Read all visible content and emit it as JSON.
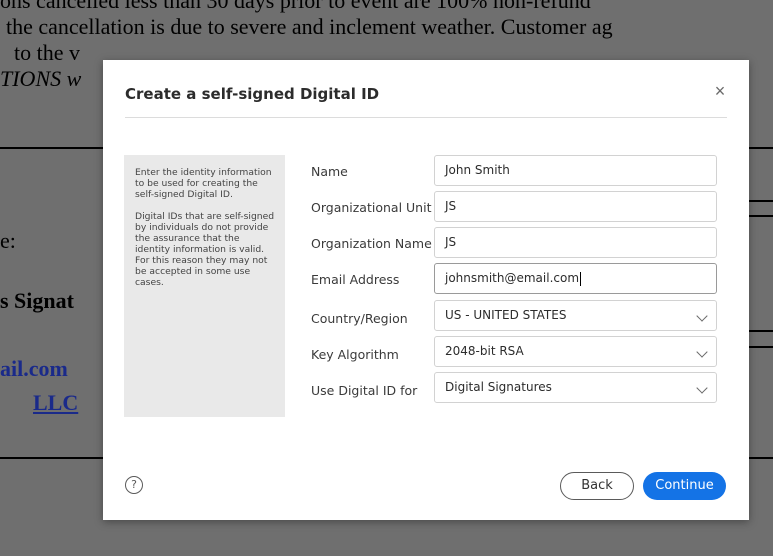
{
  "background_document": {
    "line1": "ons cancelled less than 30 days prior to event are 100% non-refund",
    "line2": "the cancellation is due to severe and inclement weather.  Customer ag",
    "line3": " to the v",
    "line4": "TIONS w",
    "line5": "e:",
    "line6": "s Signat",
    "line7": "ail.com",
    "line8": "LLC"
  },
  "dialog": {
    "title": "Create a self-signed Digital ID",
    "close_glyph": "×",
    "info_paragraph_1": "Enter the identity information to be used for creating the self-signed Digital ID.",
    "info_paragraph_2": "Digital IDs that are self-signed by individuals do not provide the assurance that the identity information is valid. For this reason they may not be accepted in some use cases.",
    "fields": {
      "name": {
        "label": "Name",
        "value": "John Smith"
      },
      "org_unit": {
        "label": "Organizational Unit",
        "value": "JS"
      },
      "org_name": {
        "label": "Organization Name",
        "value": "JS"
      },
      "email": {
        "label": "Email Address",
        "value": "johnsmith@email.com"
      },
      "country": {
        "label": "Country/Region",
        "value": "US - UNITED STATES"
      },
      "key_algorithm": {
        "label": "Key Algorithm",
        "value": "2048-bit RSA"
      },
      "use_for": {
        "label": "Use Digital ID for",
        "value": "Digital Signatures"
      }
    },
    "help_glyph": "?",
    "back_label": "Back",
    "continue_label": "Continue",
    "accent_color": "#1473e6"
  }
}
